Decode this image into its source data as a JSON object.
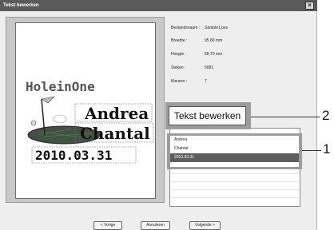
{
  "window": {
    "title": "Tekst bewerken",
    "close_glyph": "×"
  },
  "preview": {
    "logo_text": "HoleinOne",
    "lines": [
      "Andrea",
      "Chantal",
      "2010.03.31"
    ]
  },
  "info": [
    {
      "label": "Bestandsnaam :",
      "value": "Sample1.pes"
    },
    {
      "label": "Breedte :",
      "value": "95.80  mm"
    },
    {
      "label": "Hoogte :",
      "value": "58.70  mm"
    },
    {
      "label": "Steken :",
      "value": "5081"
    },
    {
      "label": "Kleuren :",
      "value": "7"
    }
  ],
  "edit_button": {
    "label": "Tekst bewerken"
  },
  "text_list": {
    "items": [
      "Andrea",
      "Chantal",
      "2010.03.31"
    ],
    "selected_index": 2
  },
  "callouts": {
    "one": "1",
    "two": "2"
  },
  "buttons": {
    "back": "< Vorige",
    "cancel": "Annuleren",
    "next": "Volgende >"
  },
  "colors": {
    "selection": "#5e5e5e",
    "highlight_frame": "#9c9c9c",
    "flag_green": "#3a5a3a"
  }
}
